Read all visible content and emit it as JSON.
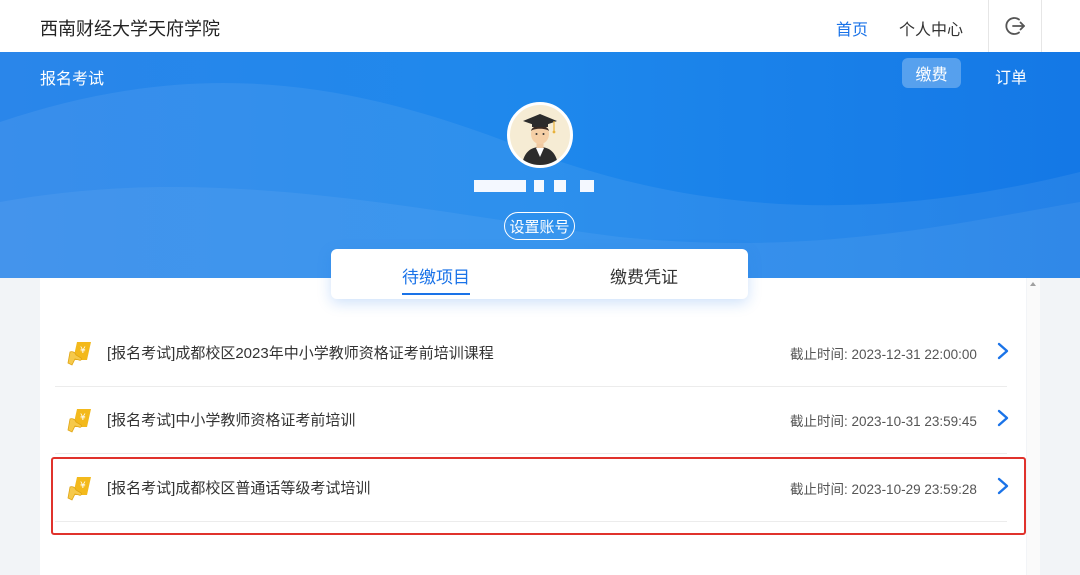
{
  "header": {
    "school_name": "西南财经大学天府学院",
    "nav": {
      "home": "首页",
      "personal_center": "个人中心"
    },
    "logout_icon": "logout-icon"
  },
  "hero": {
    "section_title": "报名考试",
    "pay_button": "缴费",
    "order_link": "订单",
    "set_account_button": "设置账号"
  },
  "tabs": {
    "pending": "待缴项目",
    "voucher": "缴费凭证",
    "active": "pending"
  },
  "items": [
    {
      "title": "[报名考试]成都校区2023年中小学教师资格证考前培训课程",
      "deadline_label": "截止时间:",
      "deadline": "2023-12-31 22:00:00"
    },
    {
      "title": "[报名考试]中小学教师资格证考前培训",
      "deadline_label": "截止时间:",
      "deadline": "2023-10-31 23:59:45"
    },
    {
      "title": "[报名考试]成都校区普通话等级考试培训",
      "deadline_label": "截止时间:",
      "deadline": "2023-10-29 23:59:28"
    }
  ],
  "colors": {
    "primary": "#1a73e8",
    "highlight_border": "#e0322c",
    "icon_yellow": "#f3b91c"
  }
}
